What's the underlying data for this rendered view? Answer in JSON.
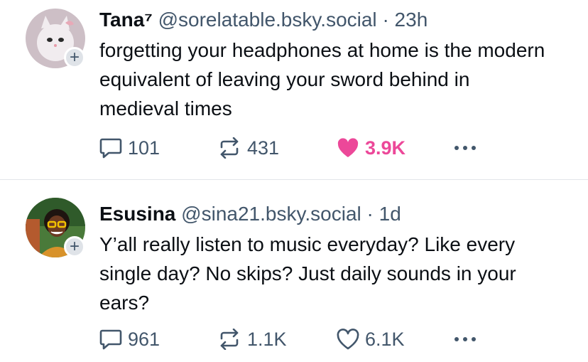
{
  "posts": [
    {
      "display_name": "Tana⁷",
      "handle": "@sorelatable.bsky.social",
      "separator": "·",
      "time": "23h",
      "text": "forgetting your headphones at home is the modern equivalent of leaving your sword behind in medieval times",
      "replies": "101",
      "reposts": "431",
      "likes": "3.9K",
      "liked": true,
      "follow_label": "+"
    },
    {
      "display_name": "Esusina",
      "handle": "@sina21.bsky.social",
      "separator": "·",
      "time": "1d",
      "text": "Y’all really listen to music everyday? Like every single day? No skips? Just daily sounds in your ears?",
      "replies": "961",
      "reposts": "1.1K",
      "likes": "6.1K",
      "liked": false,
      "follow_label": "+"
    }
  ],
  "icons": {
    "reply": "speech-bubble-icon",
    "repost": "repost-arrows-icon",
    "like": "heart-icon",
    "more": "ellipsis-icon"
  },
  "colors": {
    "like_active": "#ec4899",
    "muted": "#42566b",
    "divider": "#e3e6ea"
  }
}
